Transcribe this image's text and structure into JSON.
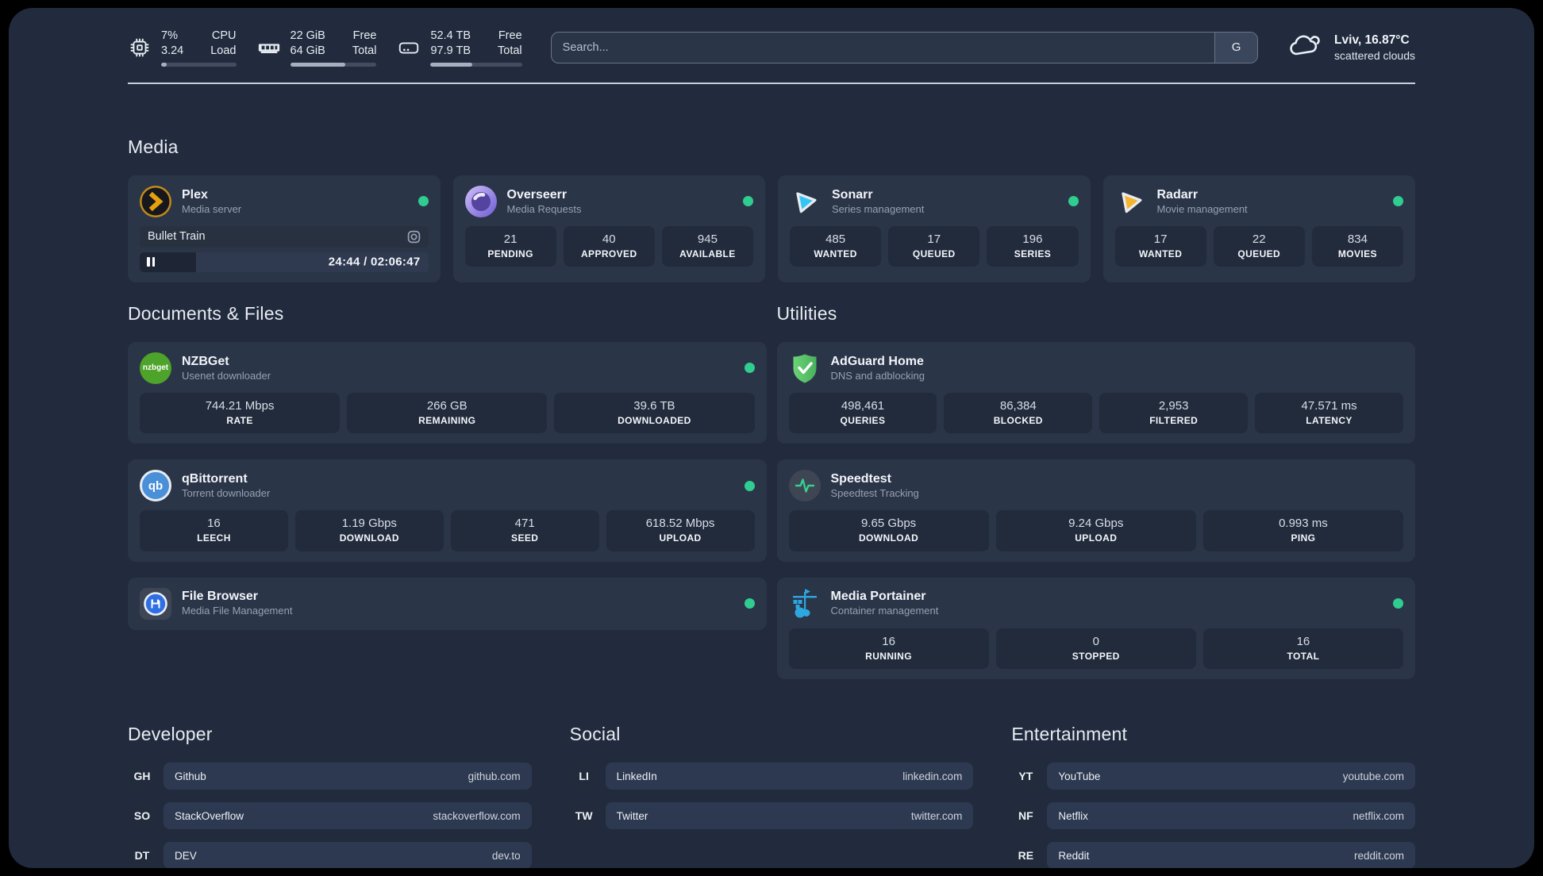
{
  "header": {
    "cpu": {
      "v1": "7%",
      "v2": "3.24",
      "l1": "CPU",
      "l2": "Load",
      "bar": "width:7%"
    },
    "ram": {
      "v1": "22 GiB",
      "v2": "64 GiB",
      "l1": "Free",
      "l2": "Total",
      "bar": "width:64%"
    },
    "disk": {
      "v1": "52.4 TB",
      "v2": "97.9 TB",
      "l1": "Free",
      "l2": "Total",
      "bar": "width:46%"
    },
    "search": {
      "placeholder": "Search...",
      "engine_label": "G"
    },
    "weather": {
      "title": "Lviv, 16.87°C",
      "subtitle": "scattered clouds"
    }
  },
  "sections": {
    "media": "Media",
    "documents": "Documents & Files",
    "utilities": "Utilities",
    "developer": "Developer",
    "social": "Social",
    "entertainment": "Entertainment"
  },
  "apps": {
    "plex": {
      "name": "Plex",
      "desc": "Media server",
      "now_playing": "Bullet Train",
      "time": "24:44 / 02:06:47",
      "progress_style": "width:19.5%"
    },
    "overseerr": {
      "name": "Overseerr",
      "desc": "Media Requests",
      "stats": [
        {
          "value": "21",
          "label": "PENDING"
        },
        {
          "value": "40",
          "label": "APPROVED"
        },
        {
          "value": "945",
          "label": "AVAILABLE"
        }
      ]
    },
    "sonarr": {
      "name": "Sonarr",
      "desc": "Series management",
      "stats": [
        {
          "value": "485",
          "label": "WANTED"
        },
        {
          "value": "17",
          "label": "QUEUED"
        },
        {
          "value": "196",
          "label": "SERIES"
        }
      ]
    },
    "radarr": {
      "name": "Radarr",
      "desc": "Movie management",
      "stats": [
        {
          "value": "17",
          "label": "WANTED"
        },
        {
          "value": "22",
          "label": "QUEUED"
        },
        {
          "value": "834",
          "label": "MOVIES"
        }
      ]
    },
    "nzbget": {
      "name": "NZBGet",
      "desc": "Usenet downloader",
      "logo_text": "nzbget",
      "stats": [
        {
          "value": "744.21 Mbps",
          "label": "RATE"
        },
        {
          "value": "266 GB",
          "label": "REMAINING"
        },
        {
          "value": "39.6 TB",
          "label": "DOWNLOADED"
        }
      ]
    },
    "qbittorrent": {
      "name": "qBittorrent",
      "desc": "Torrent downloader",
      "logo_text": "qb",
      "stats": [
        {
          "value": "16",
          "label": "LEECH"
        },
        {
          "value": "1.19 Gbps",
          "label": "DOWNLOAD"
        },
        {
          "value": "471",
          "label": "SEED"
        },
        {
          "value": "618.52 Mbps",
          "label": "UPLOAD"
        }
      ]
    },
    "filebrowser": {
      "name": "File Browser",
      "desc": "Media File Management"
    },
    "adguard": {
      "name": "AdGuard Home",
      "desc": "DNS and adblocking",
      "stats": [
        {
          "value": "498,461",
          "label": "QUERIES"
        },
        {
          "value": "86,384",
          "label": "BLOCKED"
        },
        {
          "value": "2,953",
          "label": "FILTERED"
        },
        {
          "value": "47.571 ms",
          "label": "LATENCY"
        }
      ]
    },
    "speedtest": {
      "name": "Speedtest",
      "desc": "Speedtest Tracking",
      "stats": [
        {
          "value": "9.65 Gbps",
          "label": "DOWNLOAD"
        },
        {
          "value": "9.24 Gbps",
          "label": "UPLOAD"
        },
        {
          "value": "0.993 ms",
          "label": "PING"
        }
      ]
    },
    "portainer": {
      "name": "Media Portainer",
      "desc": "Container management",
      "stats": [
        {
          "value": "16",
          "label": "RUNNING"
        },
        {
          "value": "0",
          "label": "STOPPED"
        },
        {
          "value": "16",
          "label": "TOTAL"
        }
      ]
    }
  },
  "bookmarks": {
    "developer": [
      {
        "abbr": "GH",
        "label": "Github",
        "url": "github.com"
      },
      {
        "abbr": "SO",
        "label": "StackOverflow",
        "url": "stackoverflow.com"
      },
      {
        "abbr": "DT",
        "label": "DEV",
        "url": "dev.to"
      }
    ],
    "social": [
      {
        "abbr": "LI",
        "label": "LinkedIn",
        "url": "linkedin.com"
      },
      {
        "abbr": "TW",
        "label": "Twitter",
        "url": "twitter.com"
      }
    ],
    "entertainment": [
      {
        "abbr": "YT",
        "label": "YouTube",
        "url": "youtube.com"
      },
      {
        "abbr": "NF",
        "label": "Netflix",
        "url": "netflix.com"
      },
      {
        "abbr": "RE",
        "label": "Reddit",
        "url": "reddit.com"
      }
    ]
  },
  "colors": {
    "status_online": "#2FCD8F",
    "page_bg": "#212B3D",
    "card_bg": "#2B3548",
    "stat_box_bg": "#222B3C"
  }
}
